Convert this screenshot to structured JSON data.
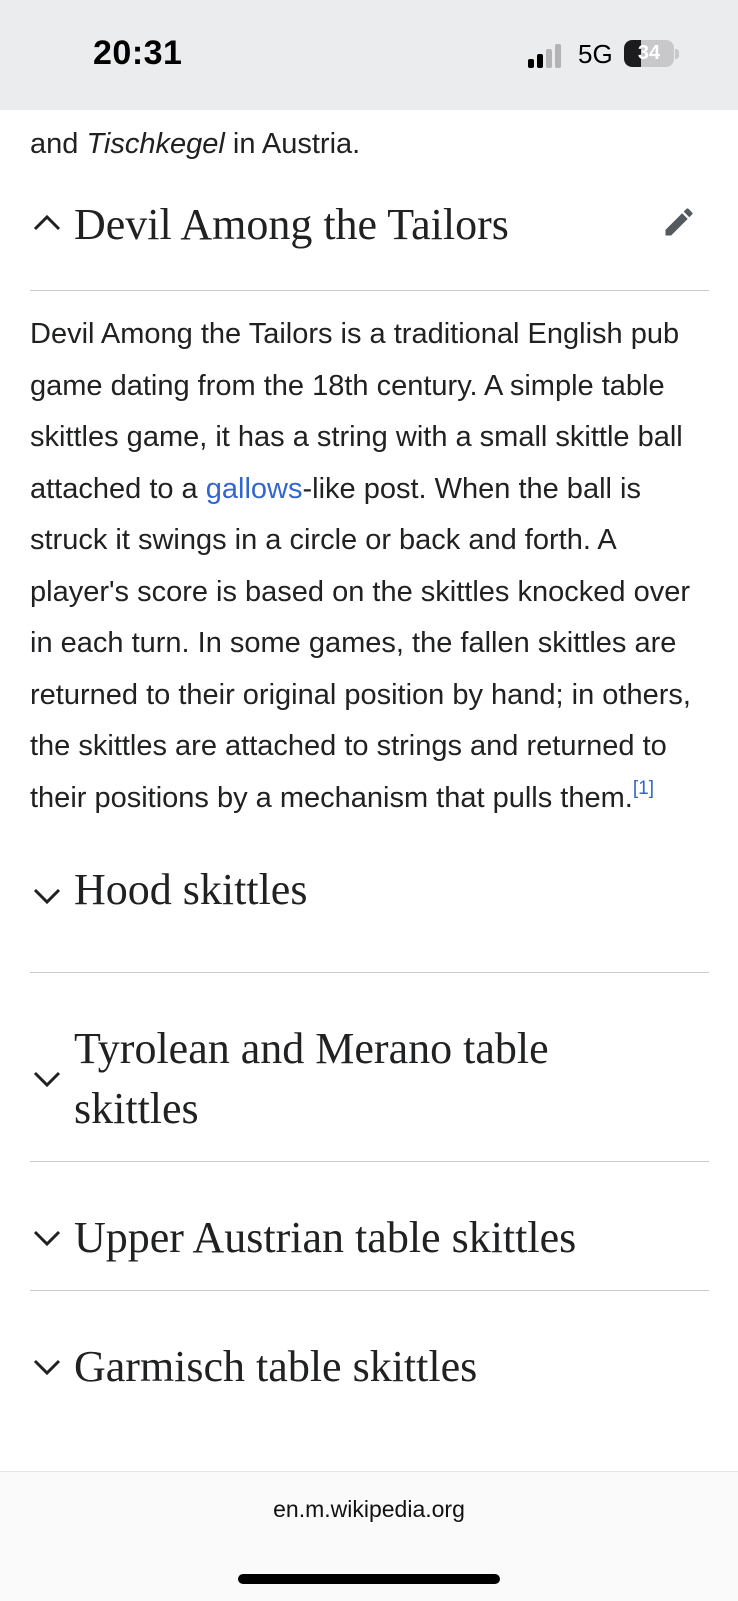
{
  "status_bar": {
    "time": "20:31",
    "network": "5G",
    "battery_level": "34",
    "signal_bars_active": 2,
    "signal_bars_total": 4
  },
  "article": {
    "fragment": {
      "before": "and ",
      "italic": "Tischkegel",
      "after": " in Austria."
    },
    "sections": [
      {
        "title": "Devil Among the Tailors",
        "expanded": true,
        "chevron": "chevron-up-icon",
        "edit_icon": "pencil-icon",
        "body": {
          "part1": "Devil Among the Tailors is a traditional English pub game dating from the 18th century. A simple table skittles game, it has a string with a small skittle ball attached to a ",
          "link": "gallows",
          "part2": "-like post. When the ball is struck it swings in a circle or back and forth. A player's score is based on the skittles knocked over in each turn. In some games, the fallen skittles are returned to their original position by hand; in others, the skittles are attached to strings and returned to their positions by a mechanism that pulls them.",
          "ref": "[1]"
        }
      },
      {
        "title": "Hood skittles",
        "expanded": false,
        "chevron": "chevron-down-icon"
      },
      {
        "title": "Tyrolean and Merano table skittles",
        "expanded": false,
        "chevron": "chevron-down-icon"
      },
      {
        "title": "Upper Austrian table skittles",
        "expanded": false,
        "chevron": "chevron-down-icon"
      },
      {
        "title": "Garmisch table skittles",
        "expanded": false,
        "chevron": "chevron-down-icon"
      }
    ]
  },
  "browser": {
    "url": "en.m.wikipedia.org"
  },
  "colors": {
    "link": "#3366cc",
    "text": "#202122",
    "divider": "#c8ccd1",
    "icon": "#54595d"
  }
}
